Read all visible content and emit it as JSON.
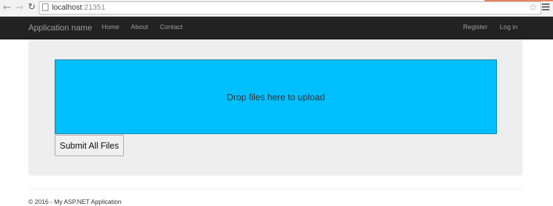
{
  "browser": {
    "url_host": "localhost",
    "url_port": ":21351",
    "icons": [
      "back-arrow-icon",
      "forward-arrow-icon",
      "reload-icon",
      "page-icon",
      "star-icon",
      "menu-icon"
    ]
  },
  "navbar": {
    "brand": "Application name",
    "links": [
      "Home",
      "About",
      "Contact"
    ],
    "register": "Register",
    "login": "Log in"
  },
  "dropzone": {
    "message": "Drop files here to upload",
    "color": "#00bfff"
  },
  "submit_button": {
    "label": "Submit All Files"
  },
  "footer": {
    "text": "© 2016 - My ASP.NET Application"
  }
}
